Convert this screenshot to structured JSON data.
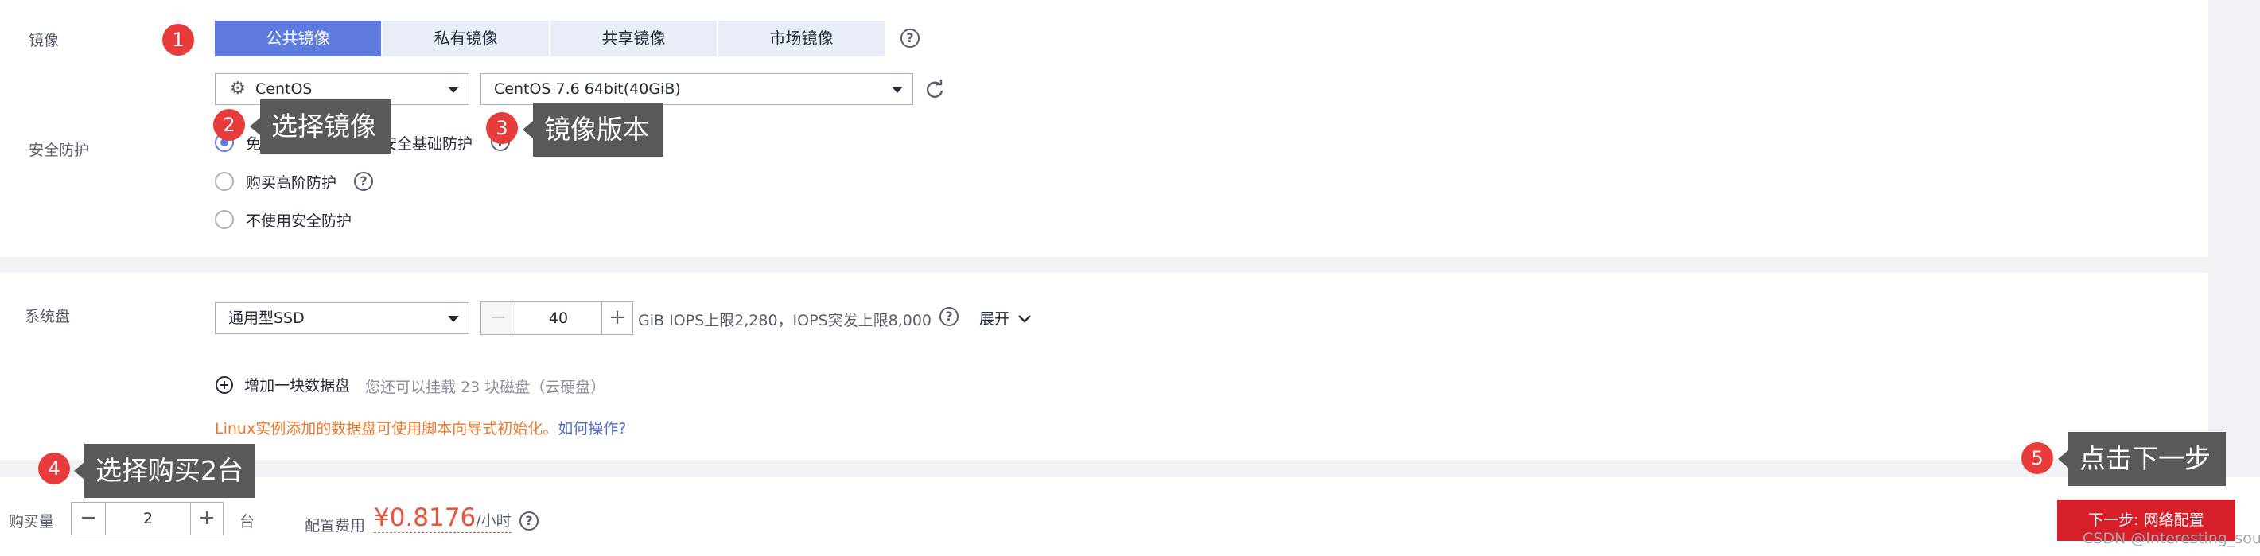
{
  "image": {
    "label": "镜像",
    "tabs": [
      {
        "label": "公共镜像",
        "active": true
      },
      {
        "label": "私有镜像",
        "active": false
      },
      {
        "label": "共享镜像",
        "active": false
      },
      {
        "label": "市场镜像",
        "active": false
      }
    ],
    "os_select": "CentOS",
    "version_select": "CentOS 7.6 64bit(40GiB)"
  },
  "security": {
    "label": "安全防护",
    "options": [
      {
        "label": "免费试用一个月主机安全基础防护",
        "checked": true
      },
      {
        "label": "购买高阶防护",
        "checked": false
      },
      {
        "label": "不使用安全防护",
        "checked": false
      }
    ]
  },
  "system_disk": {
    "label": "系统盘",
    "type": "通用型SSD",
    "size": "40",
    "size_info": "GiB IOPS上限2,280，IOPS突发上限8,000",
    "expand": "展开",
    "add_disk": "增加一块数据盘",
    "add_disk_hint": "您还可以挂载 23 块磁盘（云硬盘）",
    "linux_tip": "Linux实例添加的数据盘可使用脚本向导式初始化。",
    "howto_link": "如何操作?"
  },
  "footer": {
    "qty_label": "购买量",
    "qty": "2",
    "qty_unit": "台",
    "fee_label": "配置费用",
    "price": "¥0.8176",
    "price_unit": "/小时",
    "next_button": "下一步: 网络配置",
    "watermark": "CSDN @Interesting_soul"
  },
  "annotations": [
    {
      "num": "1"
    },
    {
      "num": "2",
      "text": "选择镜像"
    },
    {
      "num": "3",
      "text": "镜像版本"
    },
    {
      "num": "4",
      "text": "选择购买2台"
    },
    {
      "num": "5",
      "text": "点击下一步"
    }
  ],
  "colors": {
    "primary": "#5e7ce0",
    "tab_bg": "#e8edf8",
    "price_red": "#e8543b",
    "tip_orange": "#e9792c",
    "link_blue": "#526ecc",
    "button_red": "#d71f2a",
    "badge_red": "#e83b3b",
    "callout_bg": "#595959"
  }
}
